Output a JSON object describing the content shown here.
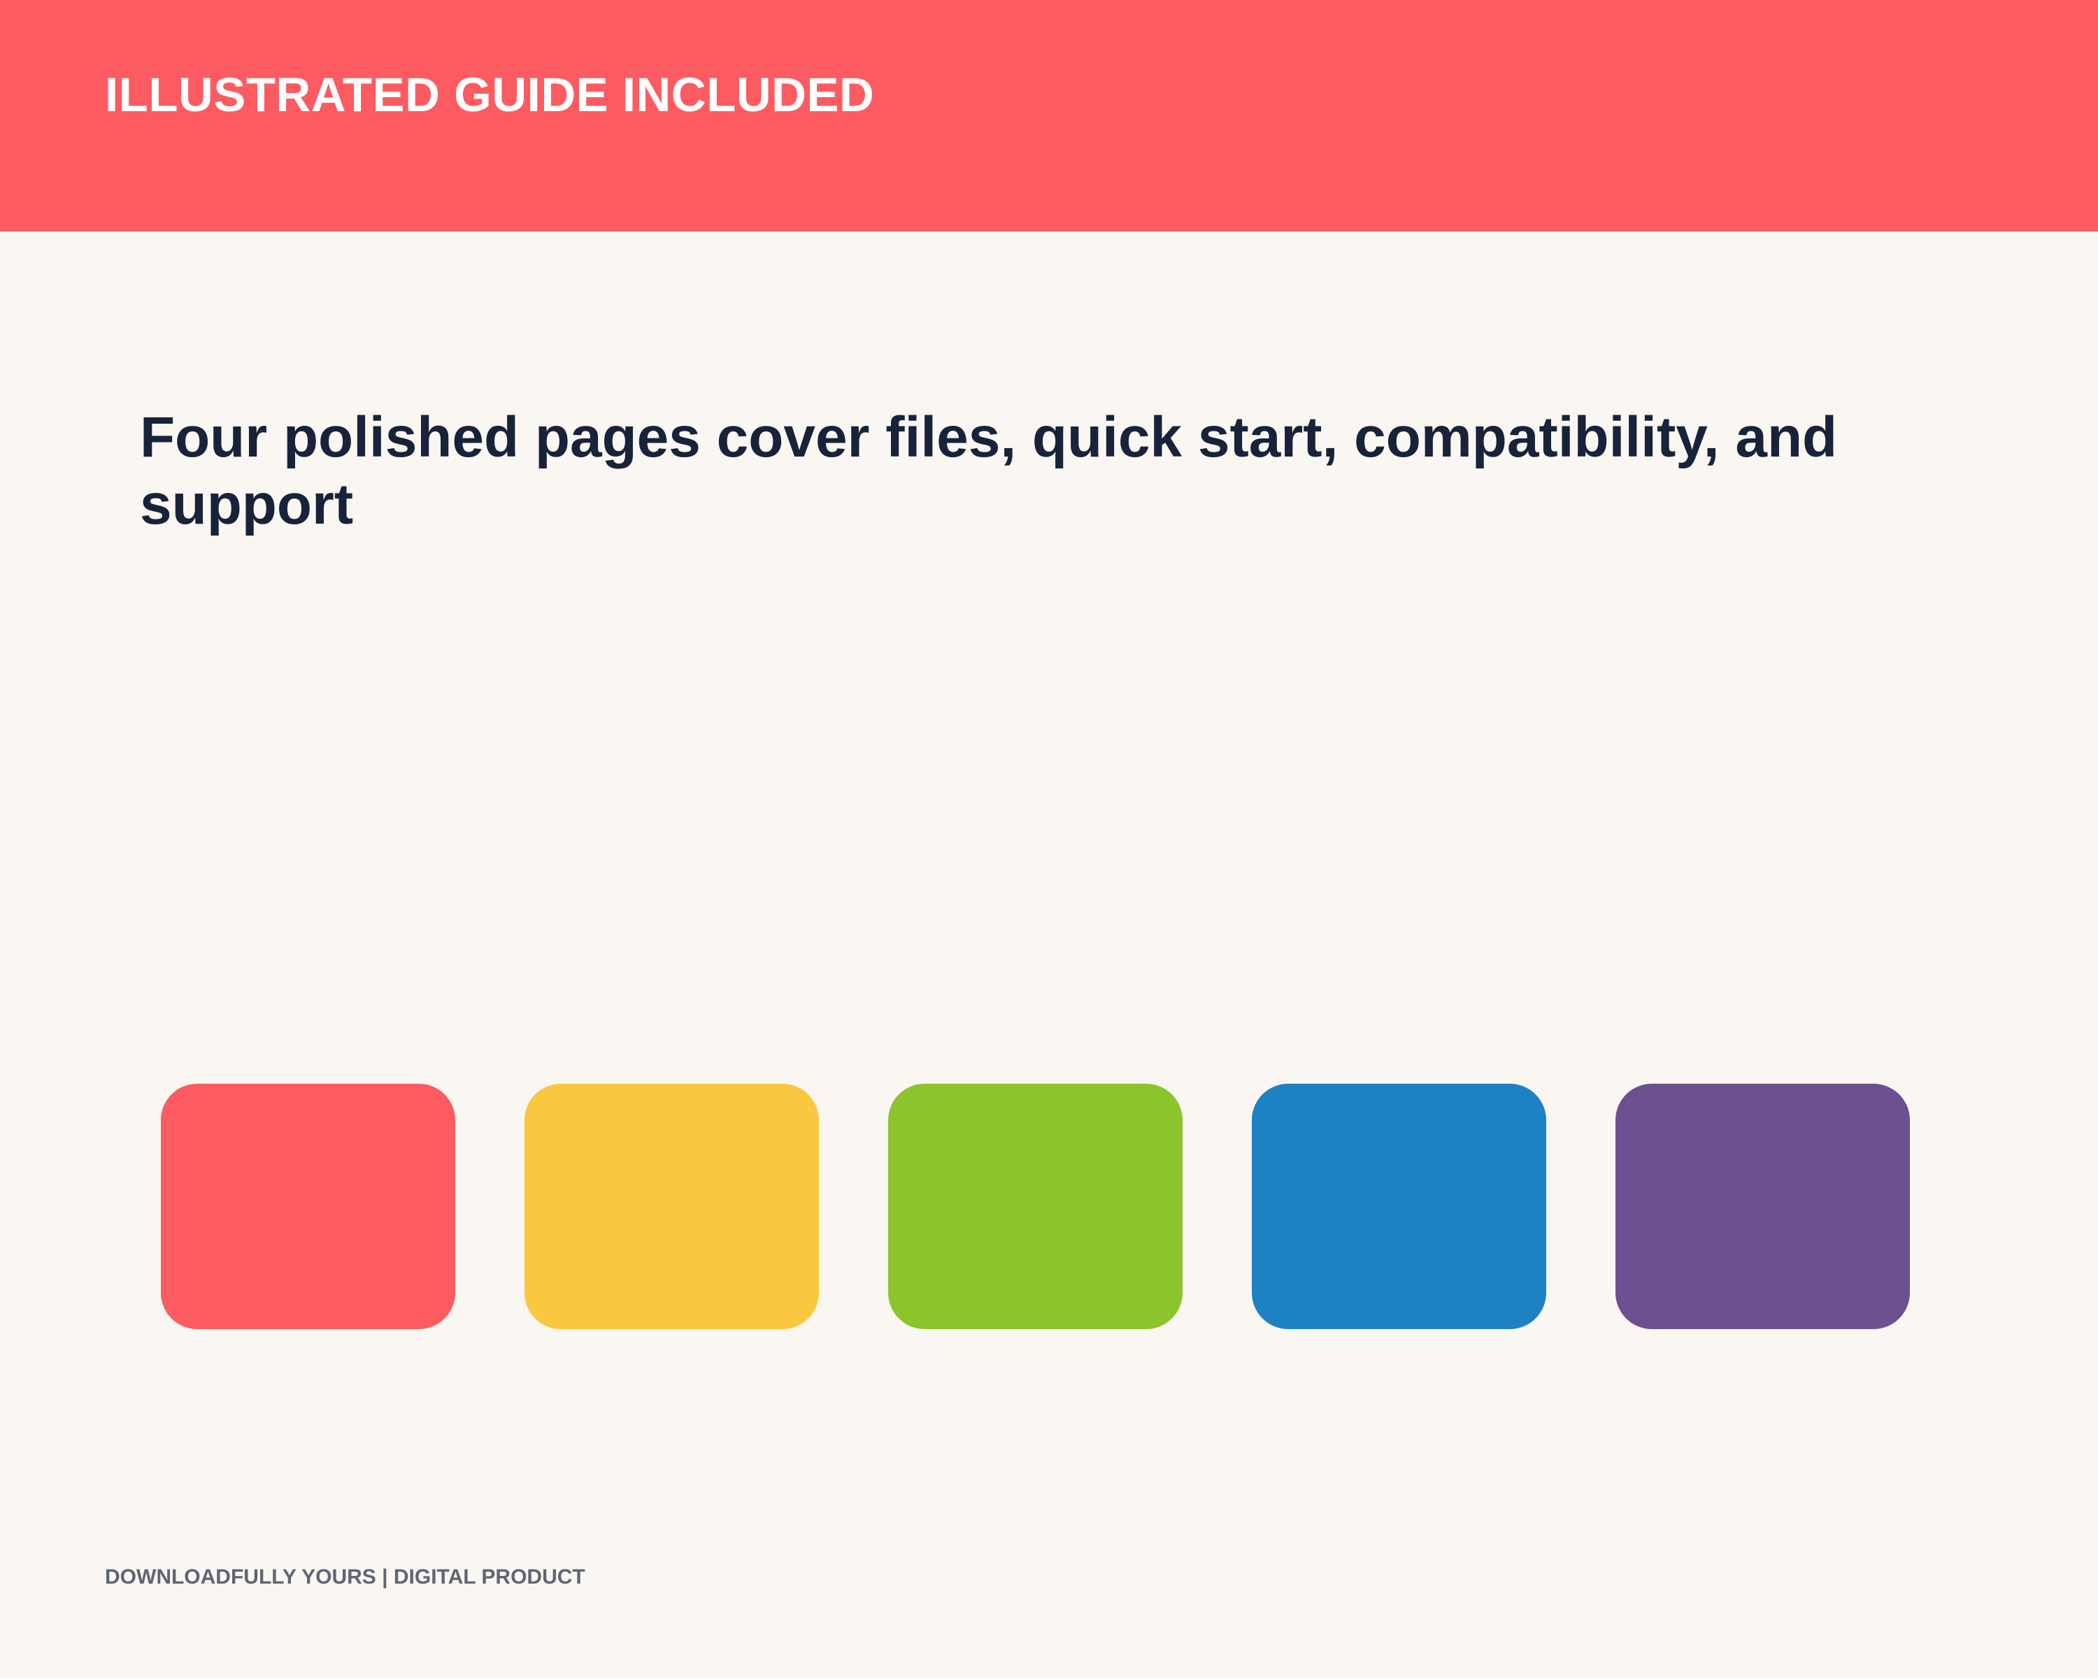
{
  "banner": {
    "title": "ILLUSTRATED GUIDE INCLUDED",
    "color": "#FC5B61"
  },
  "headline": "Four polished pages cover files, quick start, compatibility, and support",
  "swatches": [
    {
      "color": "#FC5B61"
    },
    {
      "color": "#FAC73E"
    },
    {
      "color": "#8BC52B"
    },
    {
      "color": "#1D82C3"
    },
    {
      "color": "#6C5092"
    }
  ],
  "footer": "DOWNLOADFULLY YOURS | DIGITAL PRODUCT",
  "colors": {
    "background": "#FAF6F1",
    "headline_text": "#17233A",
    "footer_text": "#5F6573"
  }
}
